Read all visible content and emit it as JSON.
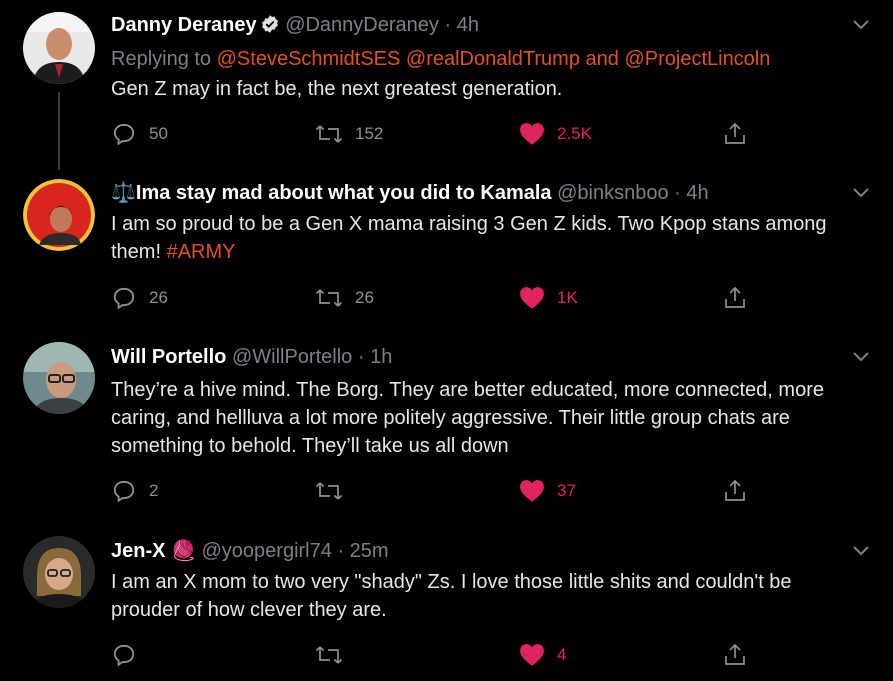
{
  "tweets": [
    {
      "name": "Danny Deraney",
      "verified": true,
      "handle": "@DannyDeraney",
      "dot": "·",
      "time": "4h",
      "replying_prefix": "Replying to",
      "replying_to": "@SteveSchmidtSES @realDonaldTrump and @ProjectLincoln",
      "text": "Gen Z may in fact be, the next greatest generation.",
      "replies": "50",
      "retweets": "152",
      "likes": "2.5K",
      "liked": true
    },
    {
      "name_emoji": "⚖️",
      "name": "Ima stay mad about what you did to Kamala",
      "handle": "@binksnboo",
      "dot": "·",
      "time": "4h",
      "text_before": "I am so proud to be a Gen X mama raising 3 Gen Z kids. Two Kpop stans among them! ",
      "hashtag": "#ARMY",
      "replies": "26",
      "retweets": "26",
      "likes": "1K",
      "liked": true
    },
    {
      "name": "Will Portello",
      "handle": "@WillPortello",
      "dot": "·",
      "time": "1h",
      "text": "They’re a hive mind.  The Borg. They are better educated, more connected, more caring, and hellluva a lot more politely aggressive. Their little group chats are something to behold. They’ll take us all down",
      "replies": "2",
      "retweets": "",
      "likes": "37",
      "liked": true
    },
    {
      "name": "Jen-X",
      "name_emoji": "🧶",
      "handle": "@yoopergirl74",
      "dot": "·",
      "time": "25m",
      "text": "I am an X mom to two very \"shady\" Zs. I love those little shits and couldn't be prouder of how clever they are.",
      "replies": "",
      "retweets": "",
      "likes": "4",
      "liked": true
    }
  ],
  "icons": {
    "reply": "reply-icon",
    "retweet": "retweet-icon",
    "like": "heart-icon",
    "share": "share-icon",
    "more": "chevron-down-icon",
    "verified": "verified-badge-icon"
  },
  "colors": {
    "background": "#000000",
    "accent": "#e0531f",
    "like": "#e0245e",
    "muted": "#7b8186"
  }
}
